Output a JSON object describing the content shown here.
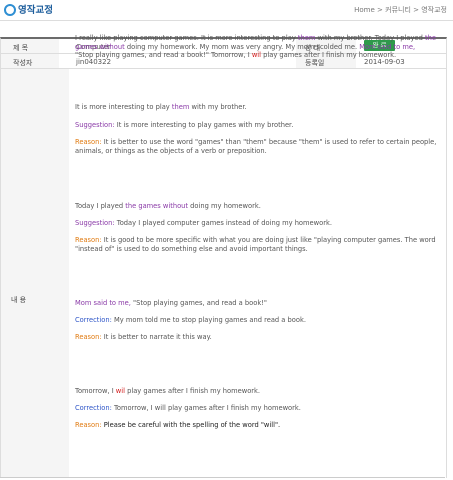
{
  "header": {
    "title": "영작교정",
    "breadcrumb": [
      "Home",
      ">",
      "커뮤니티",
      ">",
      "영작교정"
    ]
  },
  "rows": {
    "title_label": "제 목",
    "title_value": "Computer",
    "status_label": "상 태",
    "status_value": "완 료",
    "author_label": "작성자",
    "author_value": "jin040322",
    "date_label": "등록일",
    "date_value": "2014-09-03",
    "content_label": "내 용"
  },
  "content": {
    "intro": {
      "l1a": "I really like playing computer games. It is more interesting to play ",
      "them1": "them",
      "l1b": " with my brother. Today I played ",
      "the_games": "the games without",
      "l2a": " doing my homework. My mom was very angry. My mom scolded me. ",
      "mom_said": "Mom said to me,",
      "l3a": "\"Stop playing games, and read a book!\" Tomorrow, I ",
      "wil": "wil",
      "l3b": " play games after I finish my homework."
    },
    "s1": {
      "a": "It is more interesting to play ",
      "them": "them",
      "b": " with my brother.",
      "suggestion_label": "Suggestion:",
      "suggestion": " It is more interesting to play games with my brother.",
      "reason_label": "Reason:",
      "reason": " It is better to use the word \"games\" than \"them\" because \"them\" is used to refer to certain people, animals, or things as the objects of a verb or preposition."
    },
    "s2": {
      "a": "Today I played ",
      "games": "the games without",
      "b": " doing my homework.",
      "suggestion_label": "Suggestion:",
      "suggestion": " Today I played computer games instead of doing my homework.",
      "reason_label": "Reason:",
      "reason": " It is good to be more specific with what you are doing just like \"playing computer games. The word \"instead of\" is used to do something else and avoid important things."
    },
    "s3": {
      "mom": "Mom said to me,",
      "b": " \"Stop playing games, and read a book!\"",
      "correction_label": "Correction:",
      "correction": " My mom told me to stop playing games and read a book.",
      "reason_label": "Reason:",
      "reason": " It is better to narrate it this way."
    },
    "s4": {
      "a": "Tomorrow, I ",
      "wil": "wil",
      "b": " play games after I finish my homework.",
      "correction_label": "Correction:",
      "correction": " Tomorrow, I will play games after I finish my homework.",
      "reason_label": "Reason:",
      "reason": " Please be careful with the spelling of the word \"will\"."
    }
  },
  "colors": {
    "accent": "#2f8fd3",
    "status": "#2e9a4b",
    "purple": "#8a3aa7",
    "blue": "#2f56c8",
    "orange": "#e07a10",
    "red": "#d21b1b"
  }
}
